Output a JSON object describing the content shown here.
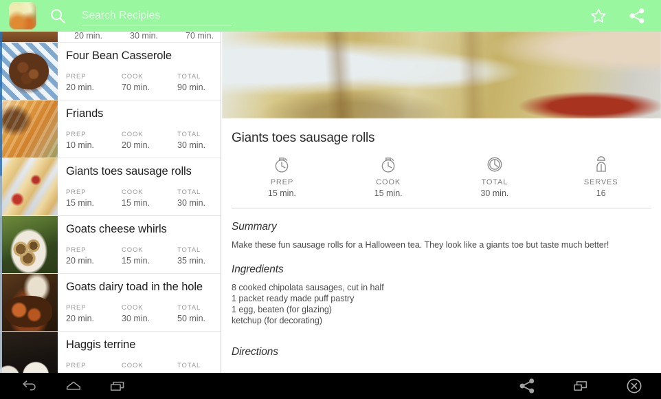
{
  "appbar": {
    "app_icon_name": "recipe-app-icon",
    "search_placeholder": "Search Recipies",
    "search_value": "",
    "favorite_icon": "star-icon",
    "share_icon": "share-icon",
    "background_color": "#99f79f"
  },
  "sidebar": {
    "partial_top_row": {
      "prep": "20 min.",
      "cook": "30 min.",
      "total": "70 min."
    },
    "stat_headers": {
      "prep": "PREP",
      "cook": "COOK",
      "total": "TOTAL"
    },
    "items": [
      {
        "title": "Four Bean Casserole",
        "prep_label": "PREP",
        "cook_label": "COOK",
        "total_label": "TOTAL",
        "prep": "20 min.",
        "cook": "70 min.",
        "total": "90 min.",
        "thumb": "t-beans"
      },
      {
        "title": "Friands",
        "prep_label": "PREP",
        "cook_label": "COOK",
        "total_label": "TOTAL",
        "prep": "10 min.",
        "cook": "20 min.",
        "total": "30 min.",
        "thumb": "t-pastry"
      },
      {
        "title": "Giants toes sausage rolls",
        "prep_label": "PREP",
        "cook_label": "COOK",
        "total_label": "TOTAL",
        "prep": "15 min.",
        "cook": "15 min.",
        "total": "30 min.",
        "thumb": "t-toes"
      },
      {
        "title": "Goats cheese whirls",
        "prep_label": "PREP",
        "cook_label": "COOK",
        "total_label": "TOTAL",
        "prep": "20 min.",
        "cook": "15 min.",
        "total": "35 min.",
        "thumb": "t-whirls"
      },
      {
        "title": "Goats dairy toad in the hole",
        "prep_label": "PREP",
        "cook_label": "COOK",
        "total_label": "TOTAL",
        "prep": "20 min.",
        "cook": "30 min.",
        "total": "50 min.",
        "thumb": "t-toad"
      },
      {
        "title": "Haggis terrine",
        "prep_label": "PREP",
        "cook_label": "COOK",
        "total_label": "TOTAL",
        "prep": "",
        "cook": "",
        "total": "",
        "thumb": "t-haggis"
      }
    ]
  },
  "detail": {
    "hero_image_name": "giants-toes-sausage-rolls-photo",
    "title": "Giants toes sausage rolls",
    "stats": [
      {
        "icon": "stopwatch-icon",
        "label": "PREP",
        "value": "15 min."
      },
      {
        "icon": "stopwatch-icon",
        "label": "COOK",
        "value": "15 min."
      },
      {
        "icon": "clock-icon",
        "label": "TOTAL",
        "value": "30 min."
      },
      {
        "icon": "person-icon",
        "label": "SERVES",
        "value": "16"
      }
    ],
    "summary_head": "Summary",
    "summary_body": "Make these fun sausage rolls for a Halloween tea. They look like a giants toe but taste much better!",
    "ingredients_head": "Ingredients",
    "ingredients": [
      "8 cooked chipolata sausages, cut in half",
      "1 packet ready made puff pastry",
      "1 egg, beaten (for glazing)",
      "ketchup (for decorating)"
    ],
    "directions_head": "Directions",
    "directions_body": ""
  },
  "navbar": {
    "back_icon": "back-arrow-icon",
    "home_icon": "home-icon",
    "recents_icon": "recent-apps-icon",
    "share_icon": "share-icon",
    "window_icon": "window-resize-icon",
    "close_icon": "close-circle-icon"
  }
}
